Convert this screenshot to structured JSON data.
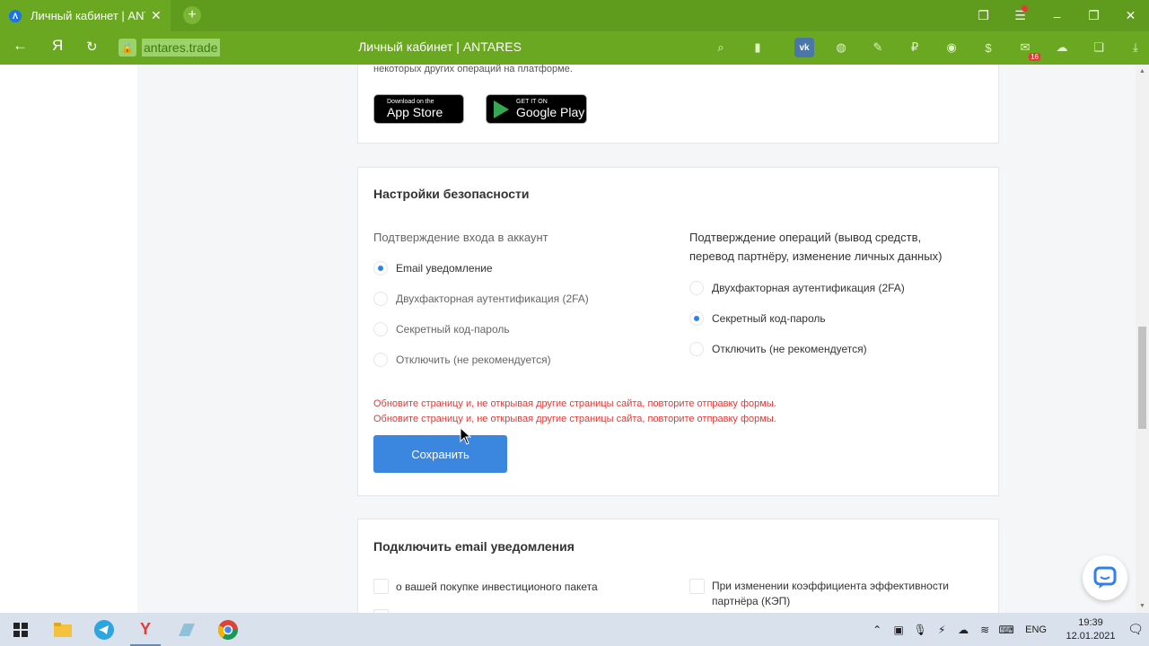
{
  "browser": {
    "tab_title": "Личный кабинет | ANTARES",
    "tab_favicon_letter": "Λ",
    "url": "antares.trade",
    "page_title": "Личный кабинет | ANTARES",
    "yandex_glyph": "Я",
    "extensions": [
      "search-icon",
      "bookmark-icon",
      "vk-icon",
      "globe-icon",
      "pen-icon",
      "ruble-icon",
      "spy-icon",
      "dollar-icon",
      "mail-icon",
      "cloud-icon",
      "collections-icon",
      "download-icon"
    ],
    "vk_label": "vk",
    "mail_count": "16"
  },
  "top_card": {
    "note": "некоторых других операций на платформе.",
    "app_store_small": "Download on the",
    "app_store_big": "App Store",
    "google_play_small": "GET IT ON",
    "google_play_big": "Google Play"
  },
  "security": {
    "title": "Настройки безопасности",
    "login": {
      "title": "Подтверждение входа в аккаунт",
      "options": [
        "Email уведомление",
        "Двухфакторная аутентификация (2FA)",
        "Секретный код-пароль",
        "Отключить (не рекомендуется)"
      ],
      "selected_index": 0
    },
    "operations": {
      "title_line1": "Подтверждение операций (вывод средств,",
      "title_line2": "перевод партнёру, изменение личных данных)",
      "options": [
        "Двухфакторная аутентификация (2FA)",
        "Секретный код-пароль",
        "Отключить (не рекомендуется)"
      ],
      "selected_index": 1
    },
    "errors": [
      "Обновите страницу и, не открывая другие страницы сайта, повторите отправку формы.",
      "Обновите страницу и, не открывая другие страницы сайта, повторите отправку формы."
    ],
    "save_label": "Сохранить"
  },
  "email": {
    "title": "Подключить email уведомления",
    "item_left": "о вашей покупке инвестиционого пакета",
    "item_right_line1": "При изменении коэффициента эффективности",
    "item_right_line2": "партнёра (КЭП)"
  },
  "taskbar": {
    "apps": [
      "file-explorer-icon",
      "telegram-icon",
      "yandex-browser-icon",
      "notes-icon",
      "chrome-icon"
    ],
    "language": "ENG",
    "time": "19:39",
    "date": "12.01.2021"
  },
  "colors": {
    "browser_green": "#6aa822",
    "primary_button": "#3b87e0",
    "error_red": "#e53935"
  }
}
